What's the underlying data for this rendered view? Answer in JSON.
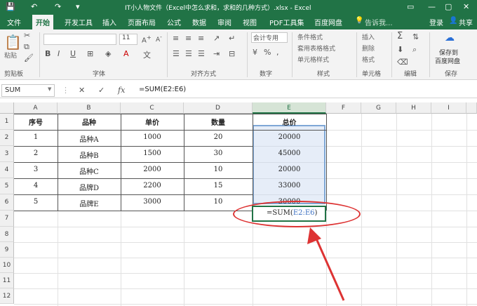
{
  "title_bar": {
    "title": "IT小人物文件（Excel中怎么求和，求和的几种方式）.xlsx - Excel"
  },
  "menu_tabs": [
    "文件",
    "开始",
    "开发工具",
    "插入",
    "页面布局",
    "公式",
    "数据",
    "审阅",
    "视图",
    "PDF工具集",
    "百度网盘"
  ],
  "active_tab": "开始",
  "tell_me": "告诉我...",
  "login": "登录",
  "share": "共享",
  "ribbon": {
    "clipboard": {
      "paste": "粘贴",
      "label": "剪贴板"
    },
    "font": {
      "size": "11",
      "label": "字体"
    },
    "alignment": {
      "label": "对齐方式"
    },
    "number": {
      "format": "会计专用",
      "label": "数字"
    },
    "styles": {
      "items": [
        "条件格式",
        "套用表格格式",
        "单元格样式"
      ],
      "label": "样式"
    },
    "cells": {
      "items": [
        "插入",
        "删除",
        "格式"
      ],
      "label": "单元格"
    },
    "editing": {
      "label": "编辑"
    },
    "save": {
      "line1": "保存到",
      "line2": "百度网盘",
      "label": "保存"
    }
  },
  "formula_bar": {
    "name_box": "SUM",
    "cancel": "✕",
    "confirm": "✓",
    "fx": "fx",
    "formula": "=SUM(E2:E6)"
  },
  "columns": [
    "A",
    "B",
    "C",
    "D",
    "E",
    "F",
    "G",
    "H",
    "I"
  ],
  "selected_column": "E",
  "rows": [
    "1",
    "2",
    "3",
    "4",
    "5",
    "6",
    "7",
    "8",
    "9",
    "10",
    "11",
    "12"
  ],
  "table": {
    "headers": [
      "序号",
      "品种",
      "单价",
      "数量",
      "总价"
    ],
    "rows": [
      [
        "1",
        "品种A",
        "1000",
        "20",
        "20000"
      ],
      [
        "2",
        "品种B",
        "1500",
        "30",
        "45000"
      ],
      [
        "3",
        "品种C",
        "2000",
        "10",
        "20000"
      ],
      [
        "4",
        "品牌D",
        "2200",
        "15",
        "33000"
      ],
      [
        "5",
        "品牌E",
        "3000",
        "10",
        "30000"
      ]
    ]
  },
  "editing_cell": {
    "prefix": "=SUM(",
    "ref": "E2:E6",
    "suffix": ")"
  },
  "colors": {
    "excel_green": "#217346",
    "annotation_red": "#dd3333"
  }
}
